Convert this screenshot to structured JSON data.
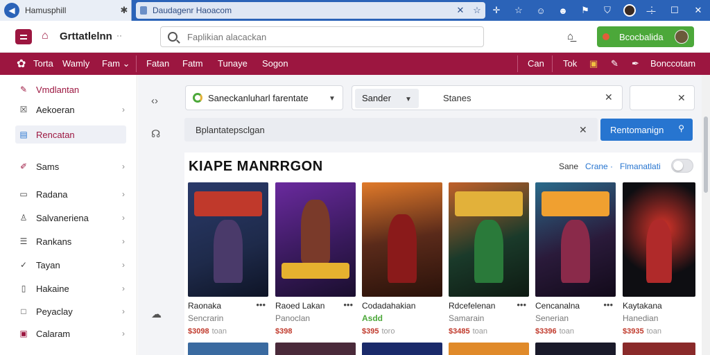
{
  "browser": {
    "tab_title": "Hamusphill",
    "url": "Daudagenr Haoacom",
    "icons": [
      "back-icon",
      "close-icon",
      "star-icon",
      "extension-icon",
      "bookmark-icon",
      "smiley-icon",
      "chat-icon",
      "flag-icon",
      "shield-icon",
      "profile-icon",
      "menu-icon"
    ],
    "window": {
      "minimize": "—",
      "maximize": "☐",
      "close": "✕"
    }
  },
  "header": {
    "brand": "Grttatlelnn",
    "search_placeholder": "Faplikian alacackan",
    "cta_label": "Bcocbalida"
  },
  "catnav": {
    "left": [
      "Torta",
      "Wamly",
      "Fam"
    ],
    "middle": [
      "Fatan",
      "Fatm",
      "Tunaye",
      "Sogon"
    ],
    "right": [
      "Can",
      "Tok",
      "Bonccotam"
    ]
  },
  "sidebar": {
    "items": [
      {
        "label": "Vmdlantan",
        "icon": "pencil-icon",
        "chevron": false
      },
      {
        "label": "Aekoeran",
        "icon": "edit-square-icon",
        "chevron": true
      },
      {
        "label": "Rencatan",
        "icon": "calendar-icon",
        "chevron": false
      },
      {
        "label": "Sams",
        "icon": "tag-icon",
        "chevron": true
      },
      {
        "label": "Radana",
        "icon": "document-icon",
        "chevron": true
      },
      {
        "label": "Salvaneriena",
        "icon": "user-icon",
        "chevron": true
      },
      {
        "label": "Rankans",
        "icon": "list-icon",
        "chevron": true
      },
      {
        "label": "Tayan",
        "icon": "wrench-icon",
        "chevron": true
      },
      {
        "label": "Hakaine",
        "icon": "bookmark-outline-icon",
        "chevron": true
      },
      {
        "label": "Peyaclay",
        "icon": "square-icon",
        "chevron": true
      },
      {
        "label": "Calaram",
        "icon": "box-icon",
        "chevron": true
      }
    ]
  },
  "filters": {
    "store_select": "Saneckanluharl farentate",
    "sort_select": "Sander",
    "sort_value": "Stanes",
    "keyword": "Bplantatepsclgan",
    "search_button": "Rentomanign"
  },
  "section": {
    "title": "KIAPE MANRRGON",
    "sort_links": [
      "Sane",
      "Crane ·",
      "Flmanatlati"
    ]
  },
  "colors": {
    "brand": "#9c1640",
    "browser": "#2b63b8",
    "cta": "#4ca83a",
    "primary_button": "#2775d0"
  },
  "games": [
    {
      "title": "Raonaka",
      "subtitle": "Sencrarin",
      "price": "$3098",
      "price_note": "toan",
      "bg": "#1e2a4a",
      "accent": "#c0392b",
      "fig": "#4a3a6a"
    },
    {
      "title": "Raoed Lakan",
      "subtitle": "Panoclan",
      "price": "$398",
      "price_note": "",
      "bg": "#3a1a5e",
      "accent": "#e6b12f",
      "fig": "#7a3a2a"
    },
    {
      "title": "Codadahakian",
      "subtitle": "",
      "price": "$395",
      "price_note": "toro",
      "price_flag": "Asdd",
      "bg": "#5a2a1a",
      "accent": "#e07a2a",
      "fig": "#8a1a1a"
    },
    {
      "title": "Rdcefelenan",
      "subtitle": "Samarain",
      "price": "$3485",
      "price_note": "toan",
      "bg": "#1a3a2a",
      "accent": "#e2b13a",
      "fig": "#2a7a3a"
    },
    {
      "title": "Cencanalna",
      "subtitle": "Senerian",
      "price": "$3396",
      "price_note": "toan",
      "bg": "#2a1a3a",
      "accent": "#f0a030",
      "fig": "#8a2a4a"
    },
    {
      "title": "Kaytakana",
      "subtitle": "Hanedian",
      "price": "$3935",
      "price_note": "toan",
      "bg": "#0e0e12",
      "accent": "#d8342a",
      "fig": "#b02a2a"
    }
  ]
}
